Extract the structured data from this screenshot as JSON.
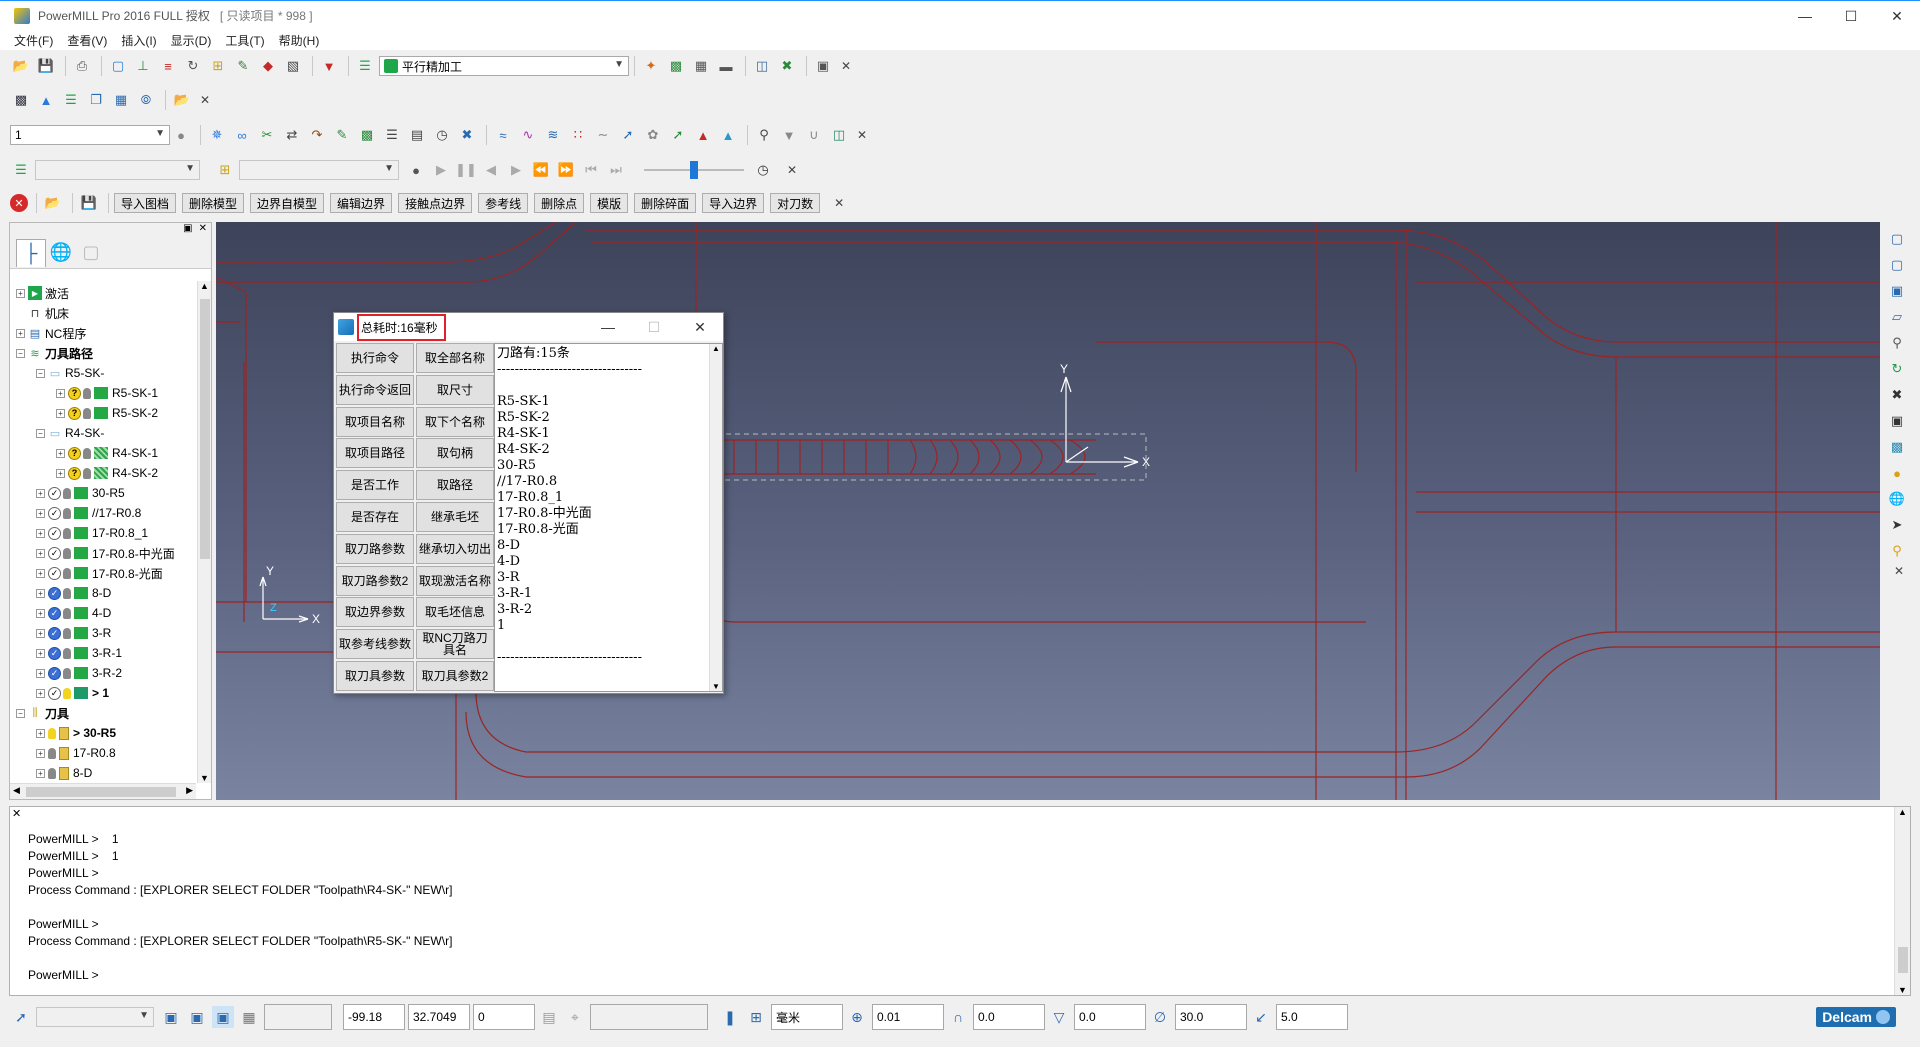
{
  "window": {
    "title": "PowerMILL Pro 2016 FULL 授权",
    "project": "[ 只读项目 * 998 ]"
  },
  "menu": [
    "文件(F)",
    "查看(V)",
    "插入(I)",
    "显示(D)",
    "工具(T)",
    "帮助(H)"
  ],
  "toolbar1": {
    "strategy_combo": "平行精加工"
  },
  "toolbar3": {
    "level_combo": "1"
  },
  "toolbar5": {
    "buttons": [
      "导入图档",
      "删除模型",
      "边界自模型",
      "编辑边界",
      "接触点边界",
      "参考线",
      "删除点",
      "模版",
      "删除碎面",
      "导入边界",
      "对刀数"
    ]
  },
  "explorer": {
    "tree": [
      {
        "label": "激活",
        "level": 0,
        "type": "active"
      },
      {
        "label": "机床",
        "level": 0,
        "type": "machine"
      },
      {
        "label": "NC程序",
        "level": 0,
        "type": "nc"
      },
      {
        "label": "刀具路径",
        "level": 0,
        "type": "folder-bold"
      },
      {
        "label": "R5-SK-",
        "level": 1,
        "type": "subfolder"
      },
      {
        "label": "R5-SK-1",
        "level": 2,
        "type": "tp-warn"
      },
      {
        "label": "R5-SK-2",
        "level": 2,
        "type": "tp-warn"
      },
      {
        "label": "R4-SK-",
        "level": 1,
        "type": "subfolder"
      },
      {
        "label": "R4-SK-1",
        "level": 2,
        "type": "tp-warn-hatch"
      },
      {
        "label": "R4-SK-2",
        "level": 2,
        "type": "tp-warn-hatch"
      },
      {
        "label": "30-R5",
        "level": 1,
        "type": "tp-check"
      },
      {
        "label": "//17-R0.8",
        "level": 1,
        "type": "tp-check"
      },
      {
        "label": "17-R0.8_1",
        "level": 1,
        "type": "tp-check"
      },
      {
        "label": "17-R0.8-中光面",
        "level": 1,
        "type": "tp-check"
      },
      {
        "label": "17-R0.8-光面",
        "level": 1,
        "type": "tp-check"
      },
      {
        "label": "8-D",
        "level": 1,
        "type": "tp-on"
      },
      {
        "label": "4-D",
        "level": 1,
        "type": "tp-on"
      },
      {
        "label": "3-R",
        "level": 1,
        "type": "tp-on"
      },
      {
        "label": "3-R-1",
        "level": 1,
        "type": "tp-on"
      },
      {
        "label": "3-R-2",
        "level": 1,
        "type": "tp-on"
      },
      {
        "label": "> 1",
        "level": 1,
        "type": "tp-check-lit"
      },
      {
        "label": "刀具",
        "level": 0,
        "type": "tools-folder"
      },
      {
        "label": "> 30-R5",
        "level": 1,
        "type": "tool-lit"
      },
      {
        "label": "17-R0.8",
        "level": 1,
        "type": "tool"
      },
      {
        "label": "8-D",
        "level": 1,
        "type": "tool"
      }
    ]
  },
  "viewport": {
    "workplane_label_y": "Y",
    "workplane_label_x": "X",
    "axis_label_y": "Y",
    "axis_label_z": "Z",
    "axis_label_x": "X"
  },
  "dialog": {
    "title": "总耗时:16毫秒",
    "buttons": [
      [
        "执行命令",
        "取全部名称"
      ],
      [
        "执行命令返回",
        "取尺寸"
      ],
      [
        "取项目名称",
        "取下个名称"
      ],
      [
        "取项目路径",
        "取句柄"
      ],
      [
        "是否工作",
        "取路径"
      ],
      [
        "是否存在",
        "继承毛坯"
      ],
      [
        "取刀路参数",
        "继承切入切出"
      ],
      [
        "取刀路参数2",
        "取现激活名称"
      ],
      [
        "取边界参数",
        "取毛坯信息"
      ],
      [
        "取参考线参数",
        "取NC刀路刀具名"
      ],
      [
        "取刀具参数",
        "取刀具参数2"
      ]
    ],
    "output": "刀路有:15条\n---------------------------------\n\nR5-SK-1\nR5-SK-2\nR4-SK-1\nR4-SK-2\n30-R5\n//17-R0.8\n17-R0.8_1\n17-R0.8-中光面\n17-R0.8-光面\n8-D\n4-D\n3-R\n3-R-1\n3-R-2\n1\n\n---------------------------------"
  },
  "command_window": {
    "text": "PowerMILL >    1\nPowerMILL >    1\nPowerMILL >\nProcess Command : [EXPLORER SELECT FOLDER \"Toolpath\\R4-SK-\" NEW\\r]\n\nPowerMILL >\nProcess Command : [EXPLORER SELECT FOLDER \"Toolpath\\R5-SK-\" NEW\\r]\n\nPowerMILL >"
  },
  "statusbar": {
    "x": "-99.18",
    "y": "32.7049",
    "z": "0",
    "units": "毫米",
    "tolerance": "0.01",
    "thickness": "0.0",
    "tool_axis_thickness": "0.0",
    "angle": "30.0",
    "stepdown": "5.0",
    "brand": "Delcam"
  },
  "colors": {
    "viewport_top": "#3d4359",
    "viewport_bottom": "#7a84a0",
    "wire": "#9b2424",
    "highlight": "#e0202a"
  }
}
